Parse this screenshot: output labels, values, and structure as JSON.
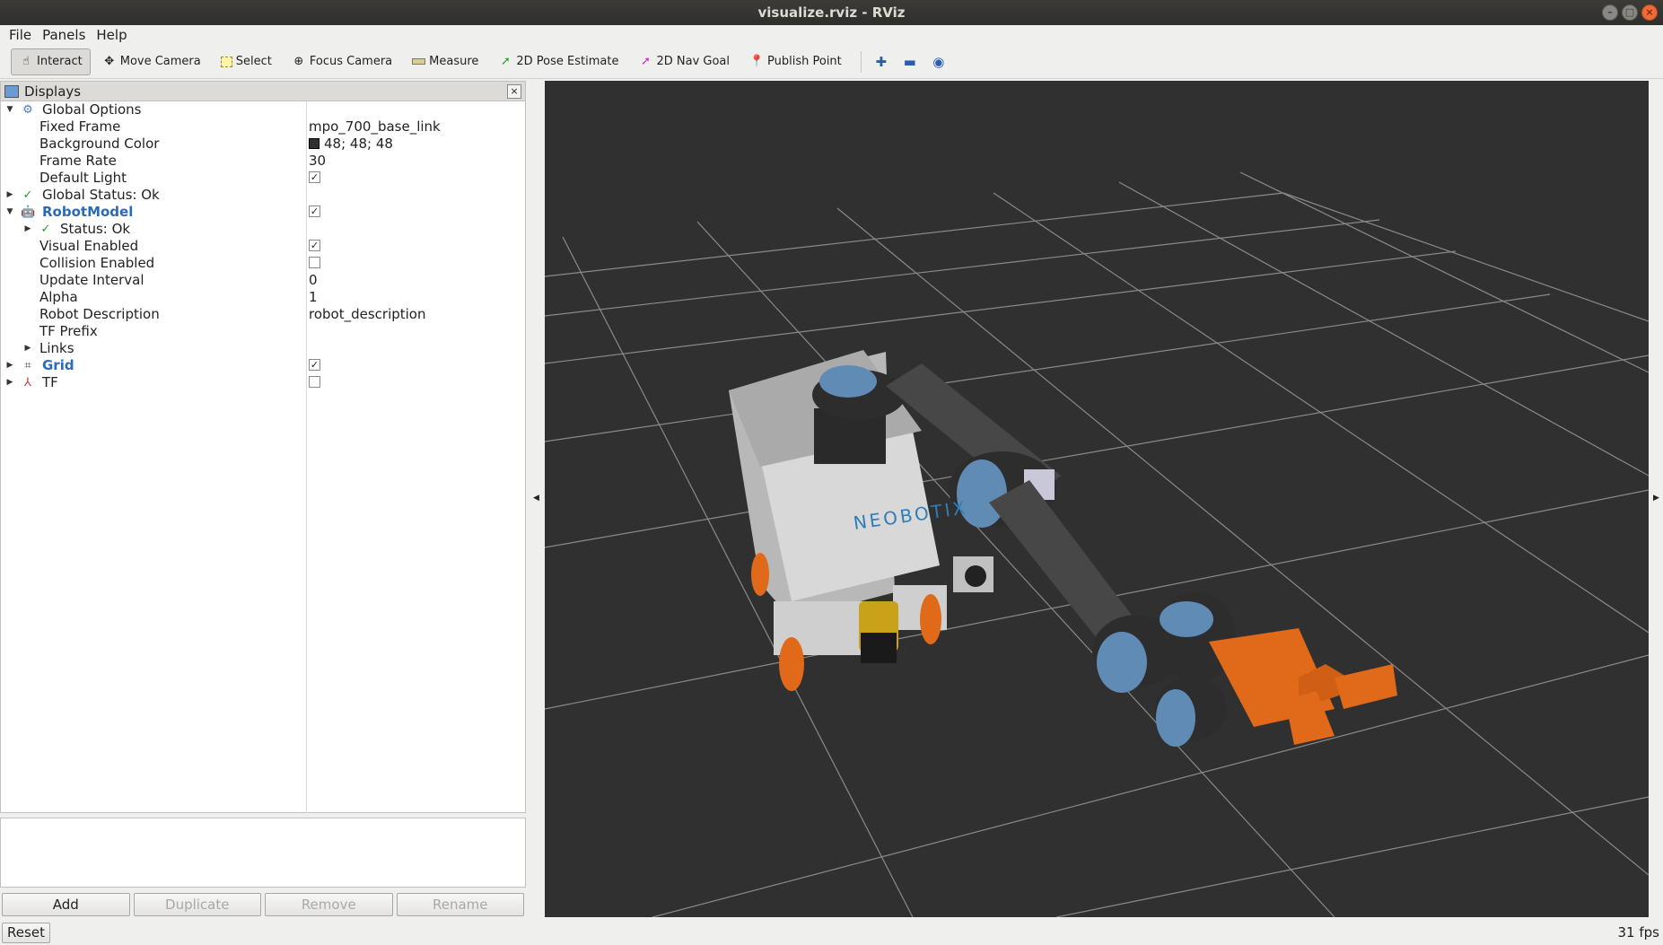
{
  "window": {
    "title": "visualize.rviz - RViz"
  },
  "menu": {
    "file": "File",
    "panels": "Panels",
    "help": "Help"
  },
  "toolbar": {
    "interact": "Interact",
    "move_camera": "Move Camera",
    "select": "Select",
    "focus_camera": "Focus Camera",
    "measure": "Measure",
    "pose_estimate": "2D Pose Estimate",
    "nav_goal": "2D Nav Goal",
    "publish_point": "Publish Point"
  },
  "displays": {
    "title": "Displays",
    "global_options": "Global Options",
    "fixed_frame_label": "Fixed Frame",
    "fixed_frame_value": "mpo_700_base_link",
    "bg_color_label": "Background Color",
    "bg_color_value": "48; 48; 48",
    "frame_rate_label": "Frame Rate",
    "frame_rate_value": "30",
    "default_light_label": "Default Light",
    "global_status": "Global Status: Ok",
    "robot_model": "RobotModel",
    "status_ok": "Status: Ok",
    "visual_enabled": "Visual Enabled",
    "collision_enabled": "Collision Enabled",
    "update_interval_label": "Update Interval",
    "update_interval_value": "0",
    "alpha_label": "Alpha",
    "alpha_value": "1",
    "robot_desc_label": "Robot Description",
    "robot_desc_value": "robot_description",
    "tf_prefix_label": "TF Prefix",
    "links": "Links",
    "grid": "Grid",
    "tf": "TF"
  },
  "buttons": {
    "add": "Add",
    "duplicate": "Duplicate",
    "remove": "Remove",
    "rename": "Rename",
    "reset": "Reset"
  },
  "status": {
    "fps": "31 fps"
  },
  "viewport": {
    "logo_text": "NEOBOTIX",
    "bg_color": "#303030"
  }
}
